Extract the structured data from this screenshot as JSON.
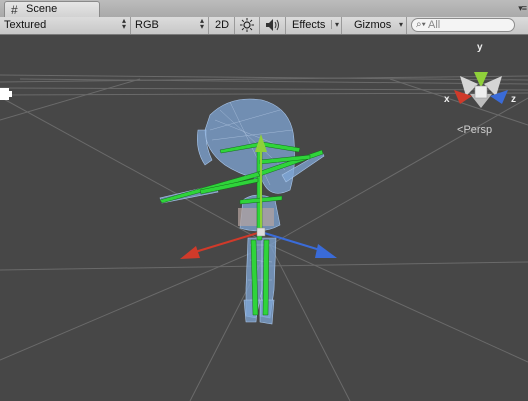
{
  "window": {
    "tab_label": "Scene",
    "tab_icon": "scene-grid-icon",
    "menu_icon": "window-menu-icon"
  },
  "toolbar": {
    "draw_mode": "Textured",
    "render_mode": "RGB",
    "mode_2d": "2D",
    "lighting_icon": "sun-icon",
    "audio_icon": "speaker-icon",
    "effects_label": "Effects",
    "gizmos_label": "Gizmos",
    "search_placeholder": "All",
    "search_icon": "magnifier-icon"
  },
  "scene": {
    "orientation_gizmo": {
      "y_label": "y",
      "x_label": "x",
      "z_label": "z",
      "projection_label": "Persp"
    },
    "colors": {
      "background": "#474747",
      "axis_x": "#d03a2a",
      "axis_y": "#8fd03a",
      "axis_z": "#3a6bd8",
      "bones": "#3ad83a",
      "model": "#7fa6d6"
    }
  }
}
